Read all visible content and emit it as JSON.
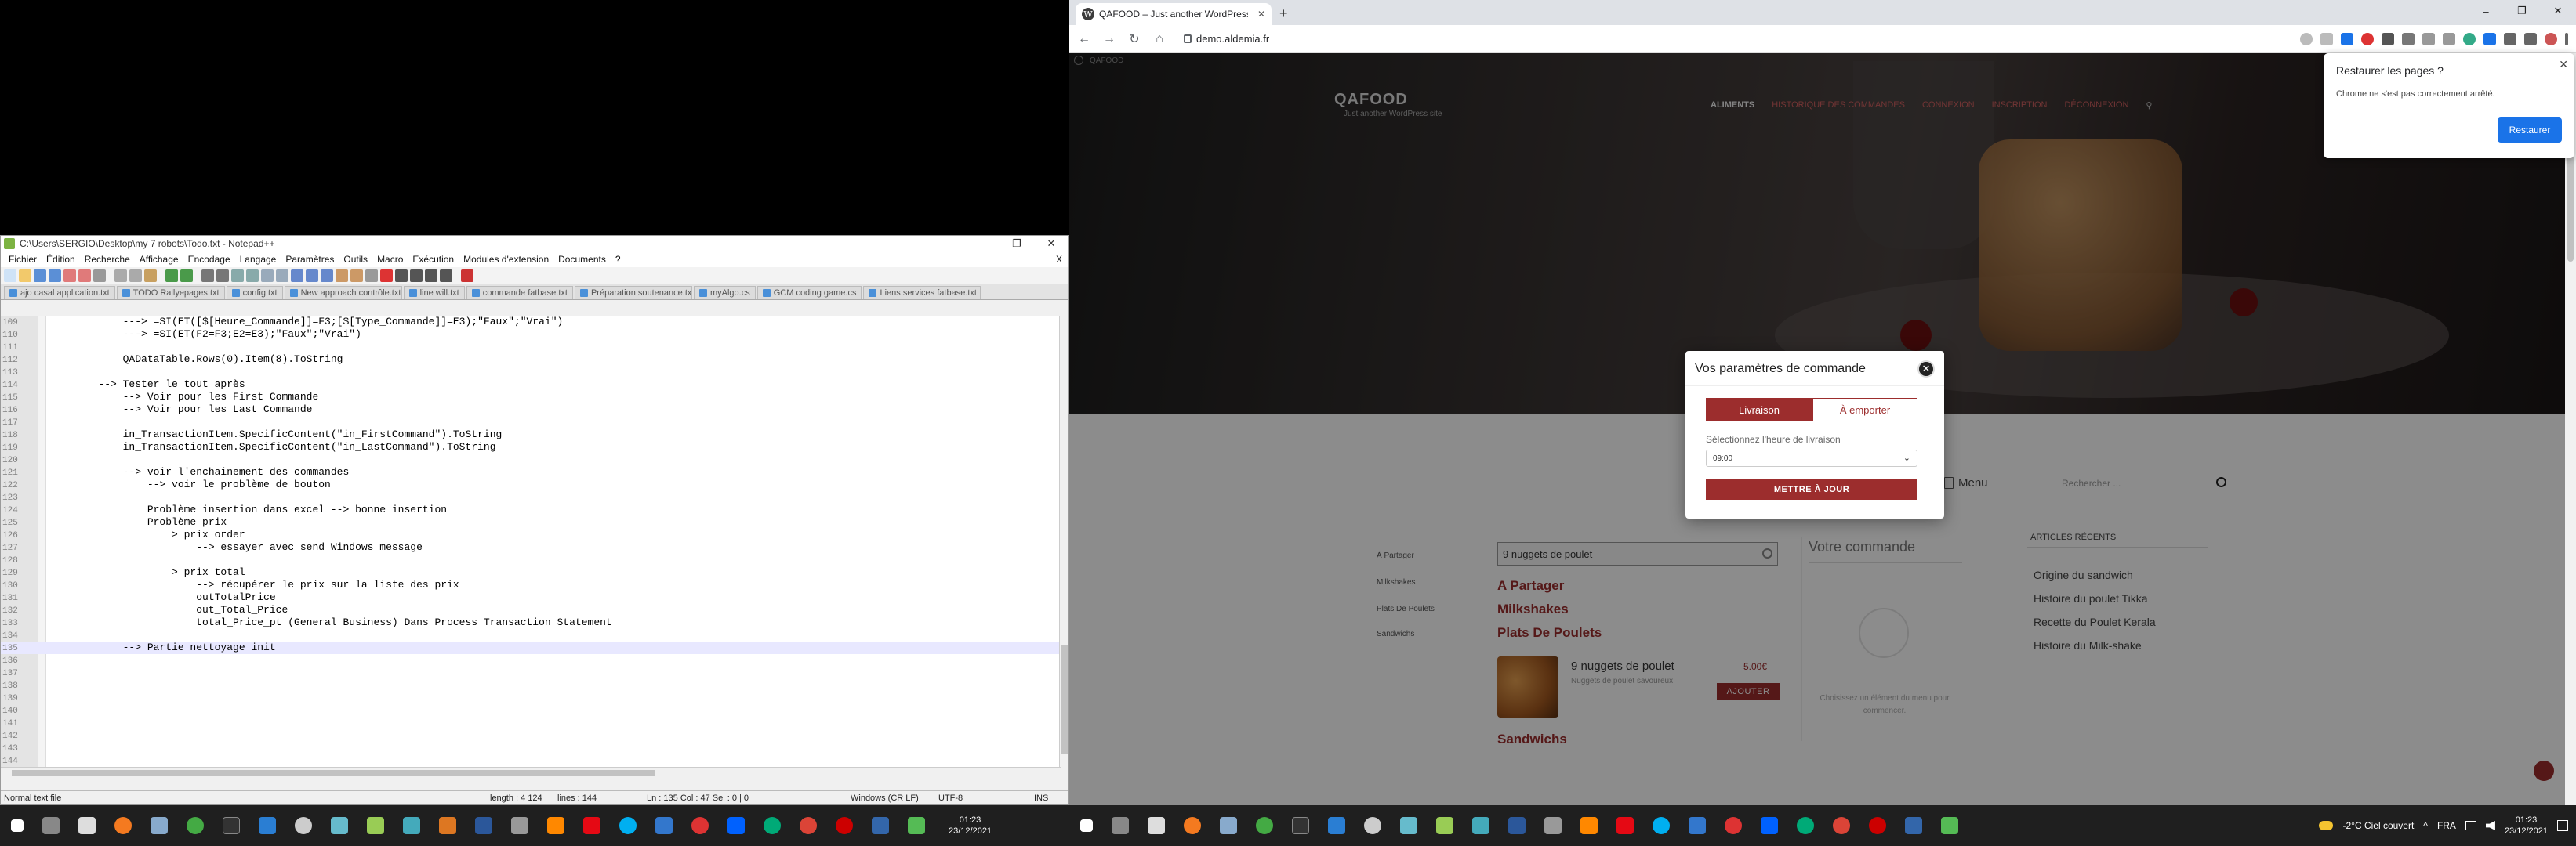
{
  "notepad": {
    "title": "C:\\Users\\SERGIO\\Desktop\\my 7 robots\\Todo.txt - Notepad++",
    "menu": [
      "Fichier",
      "Édition",
      "Recherche",
      "Affichage",
      "Encodage",
      "Langage",
      "Paramètres",
      "Outils",
      "Macro",
      "Exécution",
      "Modules d'extension",
      "Documents",
      "?"
    ],
    "close_x": "X",
    "tabs": [
      "ajo casal application.txt",
      "TODO Rallyepages.txt",
      "config.txt",
      "New approach contrôle.txt",
      "line will.txt",
      "commande fatbase.txt",
      "Préparation soutenance.txt",
      "myAlgo.cs",
      "GCM coding game.cs",
      "Liens services fatbase.txt"
    ],
    "lines": [
      {
        "n": "109",
        "t": "            ---> =SI(ET([$[Heure_Commande]]=F3;[$[Type_Commande]]=E3);\"Faux\";\"Vrai\")"
      },
      {
        "n": "110",
        "t": "            ---> =SI(ET(F2=F3;E2=E3);\"Faux\";\"Vrai\")"
      },
      {
        "n": "111",
        "t": ""
      },
      {
        "n": "112",
        "t": "            QADataTable.Rows(0).Item(8).ToString"
      },
      {
        "n": "113",
        "t": ""
      },
      {
        "n": "114",
        "t": "        --> Tester le tout après"
      },
      {
        "n": "115",
        "t": "            --> Voir pour les First Commande"
      },
      {
        "n": "116",
        "t": "            --> Voir pour les Last Commande"
      },
      {
        "n": "117",
        "t": ""
      },
      {
        "n": "118",
        "t": "            in_TransactionItem.SpecificContent(\"in_FirstCommand\").ToString"
      },
      {
        "n": "119",
        "t": "            in_TransactionItem.SpecificContent(\"in_LastCommand\").ToString"
      },
      {
        "n": "120",
        "t": ""
      },
      {
        "n": "121",
        "t": "            --> voir l'enchainement des commandes"
      },
      {
        "n": "122",
        "t": "                --> voir le problème de bouton"
      },
      {
        "n": "123",
        "t": ""
      },
      {
        "n": "124",
        "t": "                Problème insertion dans excel --> bonne insertion"
      },
      {
        "n": "125",
        "t": "                Problème prix"
      },
      {
        "n": "126",
        "t": "                    > prix order"
      },
      {
        "n": "127",
        "t": "                        --> essayer avec send Windows message"
      },
      {
        "n": "128",
        "t": ""
      },
      {
        "n": "129",
        "t": "                    > prix total"
      },
      {
        "n": "130",
        "t": "                        --> récupérer le prix sur la liste des prix"
      },
      {
        "n": "131",
        "t": "                        outTotalPrice"
      },
      {
        "n": "132",
        "t": "                        out_Total_Price"
      },
      {
        "n": "133",
        "t": "                        total_Price_pt (General Business) Dans Process Transaction Statement"
      },
      {
        "n": "134",
        "t": ""
      },
      {
        "n": "135",
        "t": "            --> Partie nettoyage init"
      },
      {
        "n": "136",
        "t": ""
      },
      {
        "n": "137",
        "t": ""
      },
      {
        "n": "138",
        "t": ""
      },
      {
        "n": "139",
        "t": ""
      },
      {
        "n": "140",
        "t": ""
      },
      {
        "n": "141",
        "t": ""
      },
      {
        "n": "142",
        "t": ""
      },
      {
        "n": "143",
        "t": ""
      },
      {
        "n": "144",
        "t": ""
      }
    ],
    "status": {
      "type": "Normal text file",
      "length": "length : 4 124",
      "lines": "lines : 144",
      "pos": "Ln : 135    Col : 47    Sel : 0 | 0",
      "eol": "Windows (CR LF)",
      "enc": "UTF-8",
      "ins": "INS"
    }
  },
  "taskbar_left": {
    "time": "01:23",
    "date": "23/12/2021"
  },
  "taskbar_right": {
    "weather": "-2°C  Ciel couvert",
    "lang": "FRA",
    "time": "01:23",
    "date": "23/12/2021"
  },
  "chrome": {
    "tab_title": "QAFOOD – Just another WordPress site",
    "tab_favicon": "W",
    "url": "demo.aldemia.fr"
  },
  "site": {
    "admin_label": "QAFOOD",
    "title": "QAFOOD",
    "subtitle": "Just another WordPress site",
    "nav": [
      "ALIMENTS",
      "HISTORIQUE DES COMMANDES",
      "CONNEXION",
      "INSCRIPTION",
      "DÉCONNEXION"
    ],
    "side_links": [
      "À Partager",
      "Milkshakes",
      "Plats De Poulets",
      "Sandwichs"
    ],
    "menu_label": "Menu",
    "search_placeholder": "Rechercher ...",
    "product_search": "9 nuggets de poulet",
    "categories": [
      "A Partager",
      "Milkshakes",
      "Plats De Poulets",
      "Sandwichs"
    ],
    "product": {
      "name": "9 nuggets de poulet",
      "desc": "Nuggets de poulet savoureux",
      "price": "5.00€",
      "add": "AJOUTER"
    },
    "cart_title": "Votre commande",
    "cart_empty": "Choisissez un élément du menu pour commencer.",
    "recent_title": "ARTICLES RÉCENTS",
    "recent": [
      "Origine du sandwich",
      "Histoire du poulet Tikka",
      "Recette du Poulet Kerala",
      "Histoire du Milk-shake"
    ]
  },
  "modal": {
    "title": "Vos paramètres de commande",
    "close": "✕",
    "opt_delivery": "Livraison",
    "opt_takeaway": "À emporter",
    "time_label": "Sélectionnez l'heure de livraison",
    "time_value": "09:00",
    "update": "METTRE À JOUR"
  },
  "restore": {
    "title": "Restaurer les pages ?",
    "msg": "Chrome ne s'est pas correctement arrêté.",
    "button": "Restaurer",
    "close": "✕"
  },
  "colors": {
    "accent": "#9c2d2d",
    "chrome_blue": "#1a73e8",
    "taskbar": "#1f1f1f"
  }
}
